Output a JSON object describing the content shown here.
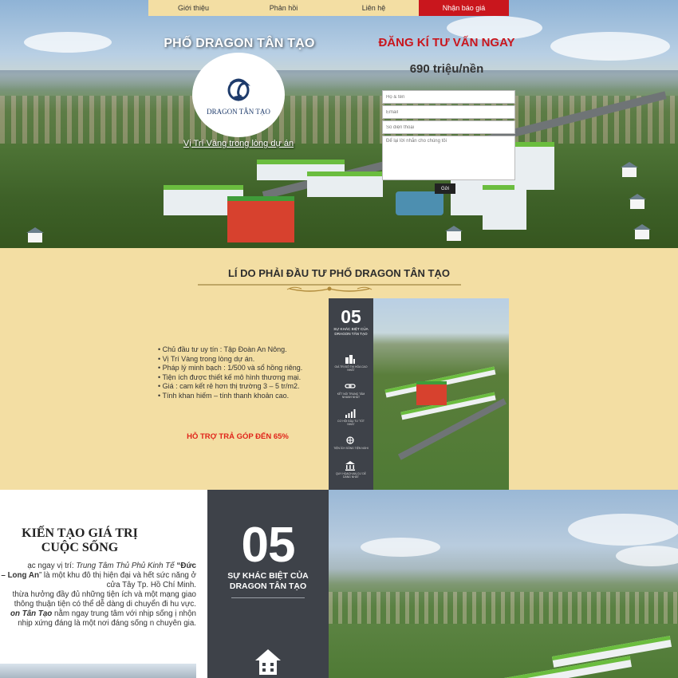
{
  "nav": {
    "items": [
      "Giới thiệu",
      "Phản hồi",
      "Liên hệ",
      "Nhận báo giá"
    ]
  },
  "hero": {
    "title": "PHỐ DRAGON TÂN TẠO",
    "logo_text": "DRAGON TÂN TẠO",
    "link_text": "Vị Trí Vàng trong lòng dự án"
  },
  "register": {
    "title": "ĐĂNG KÍ TƯ VẤN NGAY",
    "price": "690 triệu/nền",
    "name_placeholder": "Họ & tên",
    "email_placeholder": "Email",
    "phone_placeholder": "Số điện thoại",
    "message_placeholder": "Để lại lời nhắn cho chúng tôi",
    "submit_label": "Gửi"
  },
  "reasons": {
    "title": "LÍ DO PHẢI ĐẦU TƯ PHỐ DRAGON TÂN TẠO",
    "benefits": [
      "• Chủ đầu tư uy tín : Tập Đoàn An Nông.",
      "• Vị Trí Vàng trong lòng dự án.",
      "• Pháp lý minh bạch : 1/500 và sổ hồng riêng.",
      "• Tiện ích được thiết kế mô hình thương mại.",
      "• Giá : cam kết rẻ hơn thị trường 3 – 5 tr/m2.",
      "• Tính khan hiếm – tính thanh khoản cao."
    ],
    "support": "HỖ TRỢ TRẢ GÓP ĐẾN 65%",
    "promo": {
      "number": "05",
      "caption": "SỰ KHÁC BIỆT CỦA DRAGON TÂN TẠO",
      "points": [
        "GIÁ TRỊ ĐÔ THỊ HÓA CAO NHẤT",
        "KẾT NỐI TRUNG TÂM NHANH NHẤT",
        "CƠ HỘI ĐẦU TƯ TỐT NHẤT",
        "TIỆN ÍCH SỐNG TIỆN NGHI",
        "QUY HOẠCH AN CƯ DỄ DÀNG NHẤT"
      ]
    }
  },
  "lower": {
    "title_line1": "KIẾN TẠO GIÁ TRỊ",
    "title_line2": "CUỘC SỐNG",
    "p1_a": "ạc ngay vị trí: ",
    "p1_b": "Trung Tâm Thủ Phủ Kinh Tế",
    "p1_c": " “Đức",
    "p1_d": "– Long An",
    "p1_e": "” là một khu đô thị hiện đại và hết sức năng ở cửa Tây Tp. Hồ Chí Minh.",
    "p2": "thừa hưởng đầy đủ những tiện ích và một mạng giao thông thuận tiện có thể dễ dàng di chuyển đi hu vực.",
    "p3_a": "on Tân Tạo",
    "p3_b": " nằm ngay trung tâm với nhịp sống ị nhộn nhịp xứng đáng là một nơi đáng sống n chuyên gia.",
    "number": "05",
    "subtitle_line1": "SỰ KHÁC BIỆT CỦA",
    "subtitle_line2": "DRAGON TÂN TẠO"
  },
  "colors": {
    "accent_red": "#c9161d",
    "sand": "#f3dea3",
    "dark_panel": "#3e4249"
  }
}
